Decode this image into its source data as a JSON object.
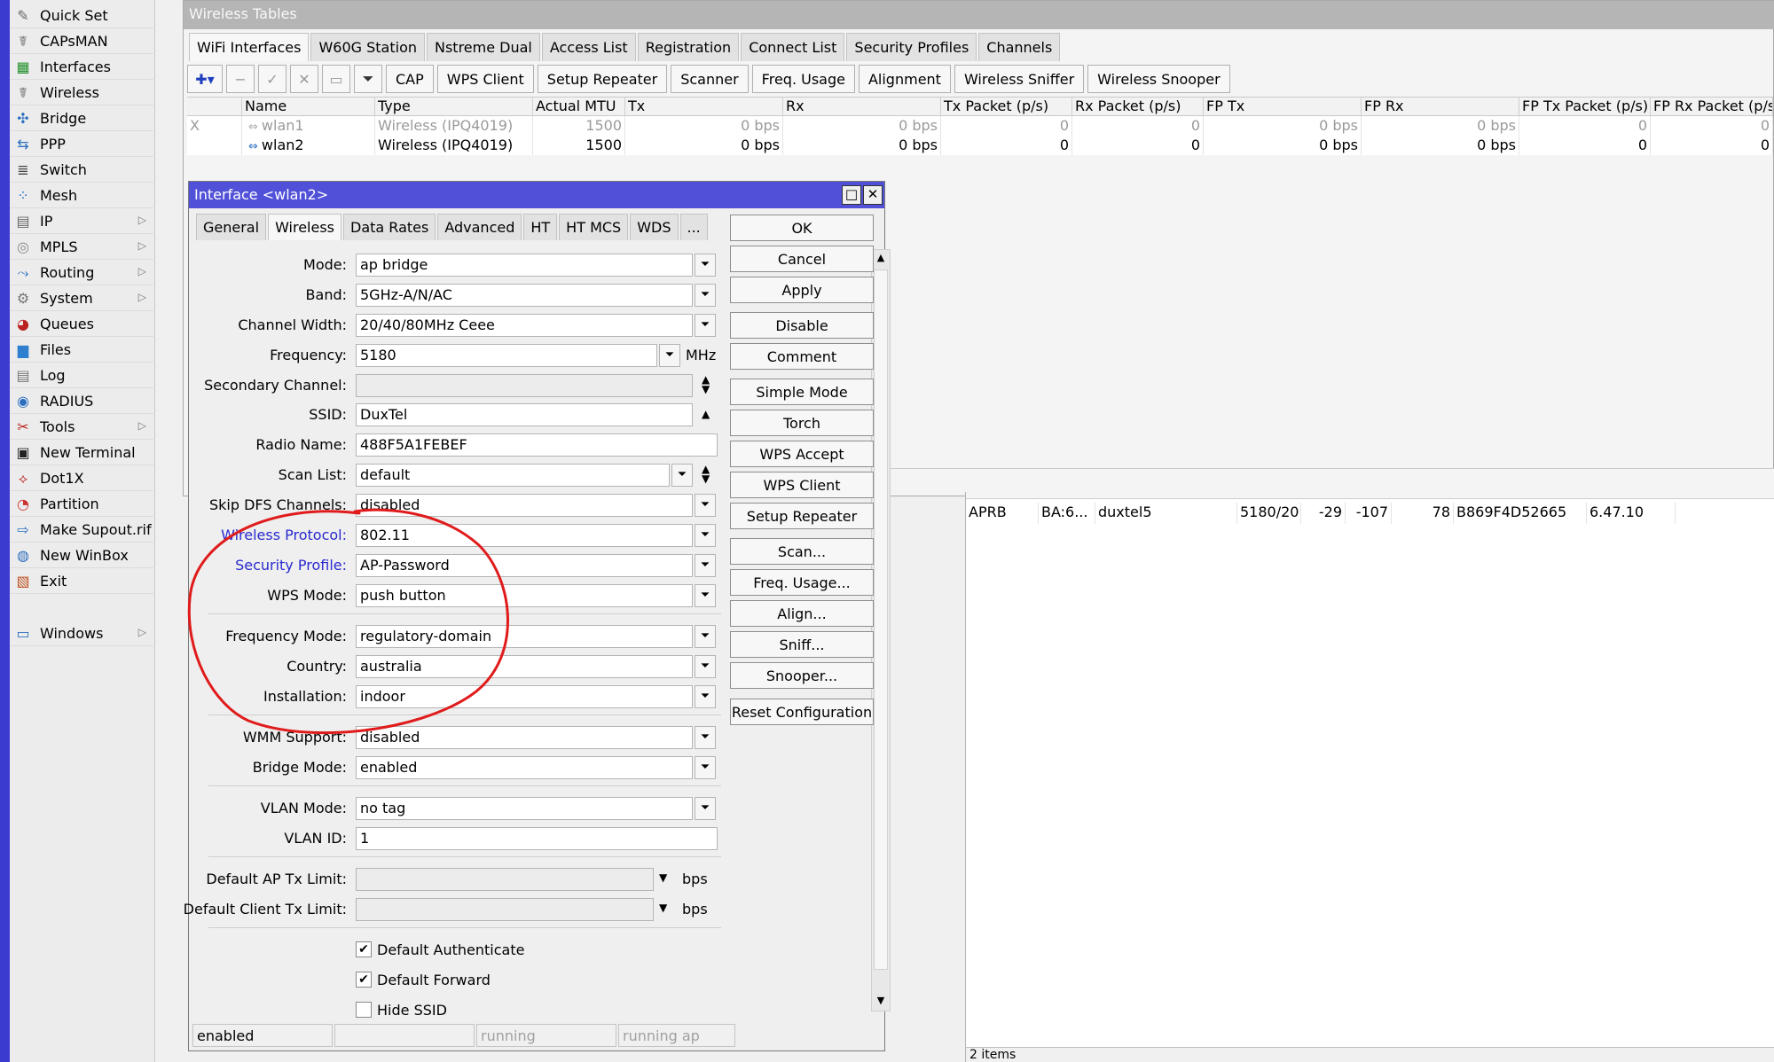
{
  "sidebar": {
    "items": [
      {
        "label": "Quick Set",
        "icon": "wand-icon",
        "arrow": false
      },
      {
        "label": "CAPsMAN",
        "icon": "antenna-icon",
        "arrow": false
      },
      {
        "label": "Interfaces",
        "icon": "interfaces-icon",
        "arrow": false
      },
      {
        "label": "Wireless",
        "icon": "wireless-icon",
        "arrow": false
      },
      {
        "label": "Bridge",
        "icon": "bridge-icon",
        "arrow": false
      },
      {
        "label": "PPP",
        "icon": "ppp-icon",
        "arrow": false
      },
      {
        "label": "Switch",
        "icon": "switch-icon",
        "arrow": false
      },
      {
        "label": "Mesh",
        "icon": "mesh-icon",
        "arrow": false
      },
      {
        "label": "IP",
        "icon": "ip-icon",
        "arrow": true
      },
      {
        "label": "MPLS",
        "icon": "mpls-icon",
        "arrow": true
      },
      {
        "label": "Routing",
        "icon": "routing-icon",
        "arrow": true
      },
      {
        "label": "System",
        "icon": "gear-icon",
        "arrow": true
      },
      {
        "label": "Queues",
        "icon": "queues-icon",
        "arrow": false
      },
      {
        "label": "Files",
        "icon": "folder-icon",
        "arrow": false
      },
      {
        "label": "Log",
        "icon": "log-icon",
        "arrow": false
      },
      {
        "label": "RADIUS",
        "icon": "radius-icon",
        "arrow": false
      },
      {
        "label": "Tools",
        "icon": "tools-icon",
        "arrow": true
      },
      {
        "label": "New Terminal",
        "icon": "terminal-icon",
        "arrow": false
      },
      {
        "label": "Dot1X",
        "icon": "dot1x-icon",
        "arrow": false
      },
      {
        "label": "Partition",
        "icon": "partition-icon",
        "arrow": false
      },
      {
        "label": "Make Supout.rif",
        "icon": "supout-icon",
        "arrow": false
      },
      {
        "label": "New WinBox",
        "icon": "winbox-icon",
        "arrow": false
      },
      {
        "label": "Exit",
        "icon": "exit-icon",
        "arrow": false
      },
      {
        "label": "Windows",
        "icon": "windows-icon",
        "arrow": true
      }
    ]
  },
  "wireless_tables": {
    "title": "Wireless Tables",
    "tabs": [
      "WiFi Interfaces",
      "W60G Station",
      "Nstreme Dual",
      "Access List",
      "Registration",
      "Connect List",
      "Security Profiles",
      "Channels"
    ],
    "toolbar": [
      "CAP",
      "WPS Client",
      "Setup Repeater",
      "Scanner",
      "Freq. Usage",
      "Alignment",
      "Wireless Sniffer",
      "Wireless Snooper"
    ],
    "columns": [
      "",
      "Name",
      "Type",
      "Actual MTU",
      "Tx",
      "Rx",
      "Tx Packet (p/s)",
      "Rx Packet (p/s)",
      "FP Tx",
      "FP Rx",
      "FP Tx Packet (p/s)",
      "FP Rx Packet (p/s)"
    ],
    "rows": [
      {
        "flag": "X",
        "name": "wlan1",
        "type": "Wireless (IPQ4019)",
        "mtu": "1500",
        "tx": "0 bps",
        "rx": "0 bps",
        "txp": "0",
        "rxp": "0",
        "fptx": "0 bps",
        "fprx": "0 bps",
        "fptxp": "0",
        "fprxp": "0"
      },
      {
        "flag": "",
        "name": "wlan2",
        "type": "Wireless (IPQ4019)",
        "mtu": "1500",
        "tx": "0 bps",
        "rx": "0 bps",
        "txp": "0",
        "rxp": "0",
        "fptx": "0 bps",
        "fprx": "0 bps",
        "fptxp": "0",
        "fprxp": "0"
      }
    ]
  },
  "scan": {
    "row": [
      "APRB",
      "BA:6...",
      "duxtel5",
      "5180/20...",
      "-29",
      "-107",
      "78",
      "B869F4D52665",
      "6.47.10"
    ],
    "footer": "2 items"
  },
  "dialog": {
    "title": "Interface <wlan2>",
    "tabs": [
      "General",
      "Wireless",
      "Data Rates",
      "Advanced",
      "HT",
      "HT MCS",
      "WDS",
      "..."
    ],
    "fields": {
      "mode": {
        "label": "Mode:",
        "value": "ap bridge"
      },
      "band": {
        "label": "Band:",
        "value": "5GHz-A/N/AC"
      },
      "channel_width": {
        "label": "Channel Width:",
        "value": "20/40/80MHz Ceee"
      },
      "frequency": {
        "label": "Frequency:",
        "value": "5180",
        "unit": "MHz"
      },
      "secondary_channel": {
        "label": "Secondary Channel:",
        "value": ""
      },
      "ssid": {
        "label": "SSID:",
        "value": "DuxTel"
      },
      "radio_name": {
        "label": "Radio Name:",
        "value": "488F5A1FEBEF"
      },
      "scan_list": {
        "label": "Scan List:",
        "value": "default"
      },
      "skip_dfs": {
        "label": "Skip DFS Channels:",
        "value": "disabled"
      },
      "wireless_protocol": {
        "label": "Wireless Protocol:",
        "value": "802.11"
      },
      "security_profile": {
        "label": "Security Profile:",
        "value": "AP-Password"
      },
      "wps_mode": {
        "label": "WPS Mode:",
        "value": "push button"
      },
      "frequency_mode": {
        "label": "Frequency Mode:",
        "value": "regulatory-domain"
      },
      "country": {
        "label": "Country:",
        "value": "australia"
      },
      "installation": {
        "label": "Installation:",
        "value": "indoor"
      },
      "wmm_support": {
        "label": "WMM Support:",
        "value": "disabled"
      },
      "bridge_mode": {
        "label": "Bridge Mode:",
        "value": "enabled"
      },
      "vlan_mode": {
        "label": "VLAN Mode:",
        "value": "no tag"
      },
      "vlan_id": {
        "label": "VLAN ID:",
        "value": "1"
      },
      "ap_tx_limit": {
        "label": "Default AP Tx Limit:",
        "value": "",
        "unit": "bps"
      },
      "client_tx_limit": {
        "label": "Default Client Tx Limit:",
        "value": "",
        "unit": "bps"
      }
    },
    "checkboxes": [
      {
        "label": "Default Authenticate",
        "checked": true
      },
      {
        "label": "Default Forward",
        "checked": true
      },
      {
        "label": "Hide SSID",
        "checked": false
      }
    ],
    "buttons": [
      "OK",
      "Cancel",
      "Apply",
      "Disable",
      "Comment",
      "Simple Mode",
      "Torch",
      "WPS Accept",
      "WPS Client",
      "Setup Repeater",
      "Scan...",
      "Freq. Usage...",
      "Align...",
      "Sniff...",
      "Snooper...",
      "Reset Configuration"
    ],
    "status": [
      "enabled",
      "",
      "running",
      "running ap"
    ]
  },
  "colors": {
    "accent_blue": "#3b3bd0",
    "dialog_title": "#5050d8",
    "link_label": "#2a2ad0",
    "annotation_red": "#e01b1b"
  }
}
